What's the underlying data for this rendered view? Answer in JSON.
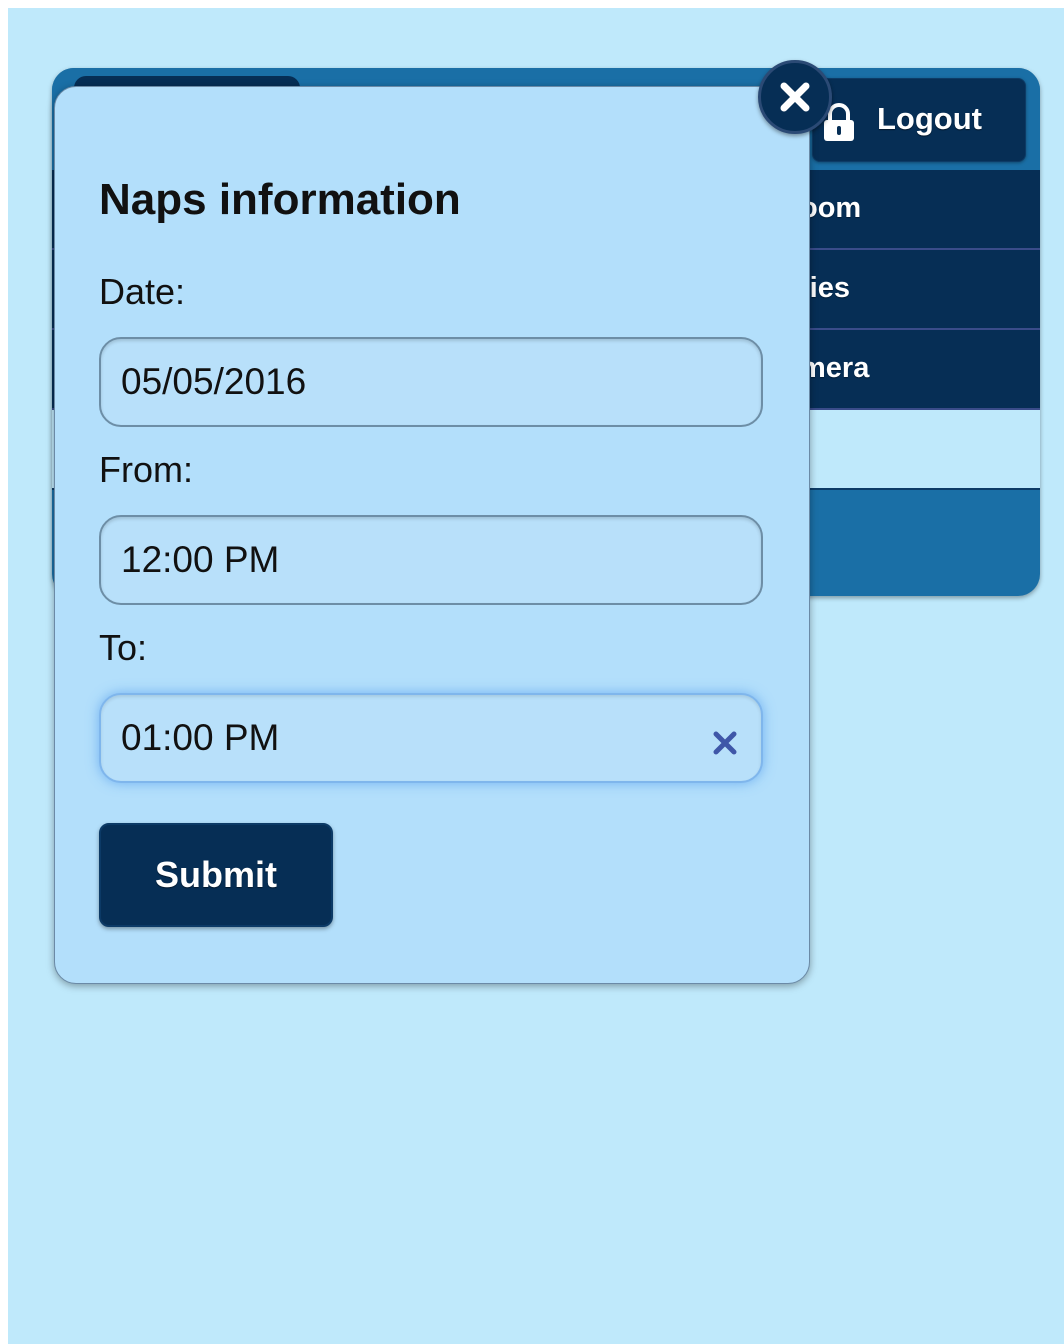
{
  "header": {
    "logout_label": "Logout"
  },
  "menu": {
    "items": [
      {
        "label": "oom"
      },
      {
        "label": "ties"
      },
      {
        "label": "mera"
      }
    ]
  },
  "dialog": {
    "title": "Naps information",
    "date_label": "Date:",
    "date_value": "05/05/2016",
    "from_label": "From:",
    "from_value": "12:00 PM",
    "to_label": "To:",
    "to_value": "01:00 PM",
    "submit_label": "Submit"
  },
  "icons": {
    "close": "close-icon",
    "lock": "lock-icon",
    "clear": "clear-icon"
  },
  "colors": {
    "page_background": "#bfe9fb",
    "primary_dark": "#062e55",
    "header_blue": "#1a6fa6",
    "dialog_background": "#b3dffb",
    "clear_icon": "#3f57a8"
  }
}
